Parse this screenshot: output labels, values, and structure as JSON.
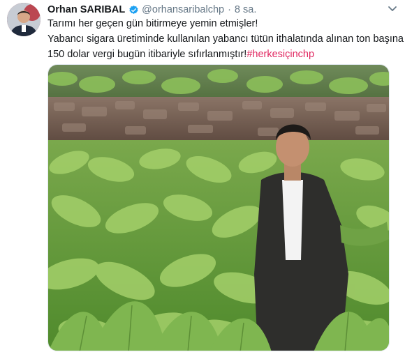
{
  "author": {
    "name": "Orhan SARIBAL",
    "handle": "@orhansaribalchp",
    "separator": "·",
    "time": "8 sa."
  },
  "icons": {
    "verified": "verified-badge-icon",
    "menu": "chevron-down-icon"
  },
  "tweet": {
    "line1": "Tarımı her geçen gün bitirmeye yemin etmişler!",
    "line2": "Yabancı sigara üretiminde kullanılan yabancı tütün ithalatında alınan ton başına",
    "line3": "150 dolar vergi bugün itibariyle sıfırlanmıştır!",
    "hashtag": "#herkesiçinchp"
  },
  "colors": {
    "hashtag": "#e0245e",
    "verified": "#1da1f2",
    "secondary_text": "#657786"
  }
}
